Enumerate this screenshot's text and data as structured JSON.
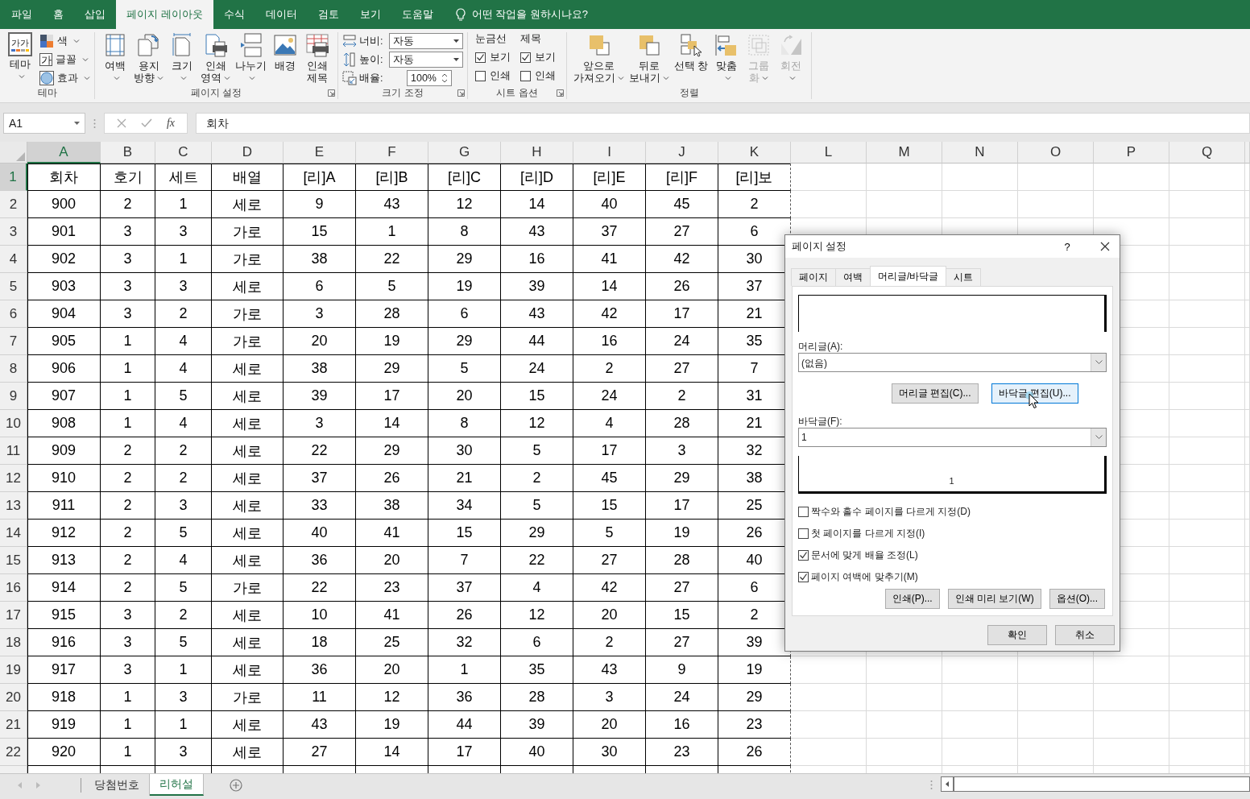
{
  "ribbon_tabs": [
    {
      "label": "파일",
      "selected": false
    },
    {
      "label": "홈",
      "selected": false
    },
    {
      "label": "삽입",
      "selected": false
    },
    {
      "label": "페이지 레이아웃",
      "selected": true
    },
    {
      "label": "수식",
      "selected": false
    },
    {
      "label": "데이터",
      "selected": false
    },
    {
      "label": "검토",
      "selected": false
    },
    {
      "label": "보기",
      "selected": false
    },
    {
      "label": "도움말",
      "selected": false
    }
  ],
  "tell_me": "어떤 작업을 원하시나요?",
  "ribbon_groups": [
    {
      "kind": "theme",
      "label": "테마",
      "buttons": [
        {
          "kind": "theme",
          "glyph": "가가",
          "lines": [
            "테마"
          ],
          "menu": true,
          "disabled": false
        }
      ],
      "small_items": [
        {
          "kind": "colors",
          "label": "색",
          "menu": true
        },
        {
          "kind": "fonts",
          "glyph": "가",
          "label": "글꼴",
          "menu": true
        },
        {
          "kind": "effects",
          "label": "효과",
          "menu": true
        }
      ]
    },
    {
      "kind": "buttons",
      "label": "페이지 설정",
      "launcher": true,
      "buttons": [
        {
          "kind": "margins",
          "lines": [
            "여백"
          ],
          "menu": true,
          "disabled": false
        },
        {
          "kind": "orientation",
          "lines": [
            "용지",
            "방향"
          ],
          "menu": true,
          "disabled": false
        },
        {
          "kind": "size",
          "lines": [
            "크기"
          ],
          "menu": true,
          "disabled": false
        },
        {
          "kind": "print_area",
          "lines": [
            "인쇄",
            "영역"
          ],
          "menu": true,
          "disabled": false
        },
        {
          "kind": "breaks",
          "lines": [
            "나누기"
          ],
          "menu": true,
          "disabled": false
        },
        {
          "kind": "background",
          "lines": [
            "배경"
          ],
          "menu": false,
          "disabled": false
        },
        {
          "kind": "print_titles",
          "lines": [
            "인쇄",
            "제목"
          ],
          "menu": false,
          "disabled": false
        }
      ]
    },
    {
      "kind": "scale",
      "label": "크기 조정",
      "launcher": true,
      "fields": [
        {
          "kind": "dropdown",
          "label": "너비:",
          "value": "자동"
        },
        {
          "kind": "dropdown",
          "label": "높이:",
          "value": "자동"
        },
        {
          "kind": "spinner",
          "label": "배율:",
          "value": "100%"
        }
      ]
    },
    {
      "kind": "sheet_options",
      "label": "시트 옵션",
      "launcher": true,
      "columns": [
        {
          "title": "눈금선",
          "items": [
            {
              "label": "보기",
              "checked": true
            },
            {
              "label": "인쇄",
              "checked": false
            }
          ]
        },
        {
          "title": "제목",
          "items": [
            {
              "label": "보기",
              "checked": true
            },
            {
              "label": "인쇄",
              "checked": false
            }
          ]
        }
      ]
    },
    {
      "kind": "buttons",
      "label": "정렬",
      "launcher": false,
      "buttons": [
        {
          "kind": "bring_forward",
          "lines": [
            "앞으로",
            "가져오기"
          ],
          "menu": true,
          "disabled": false
        },
        {
          "kind": "send_backward",
          "lines": [
            "뒤로",
            "보내기"
          ],
          "menu": true,
          "disabled": false
        },
        {
          "kind": "selection_pane",
          "lines": [
            "선택 창"
          ],
          "menu": false,
          "disabled": false
        },
        {
          "kind": "align",
          "lines": [
            "맞춤"
          ],
          "menu": true,
          "disabled": false
        },
        {
          "kind": "group",
          "lines": [
            "그룹",
            "화"
          ],
          "menu": true,
          "disabled": true
        },
        {
          "kind": "rotate",
          "lines": [
            "회전"
          ],
          "menu": true,
          "disabled": true
        }
      ]
    }
  ],
  "formula_bar": {
    "name_box": "A1",
    "function_label": "fx",
    "value": "회차"
  },
  "sheet": {
    "columns": [
      {
        "label": "A",
        "selected": true
      },
      {
        "label": "B",
        "selected": false
      },
      {
        "label": "C",
        "selected": false
      },
      {
        "label": "D",
        "selected": false
      },
      {
        "label": "E",
        "selected": false
      },
      {
        "label": "F",
        "selected": false
      },
      {
        "label": "G",
        "selected": false
      },
      {
        "label": "H",
        "selected": false
      },
      {
        "label": "I",
        "selected": false
      },
      {
        "label": "J",
        "selected": false
      },
      {
        "label": "K",
        "selected": false
      },
      {
        "label": "L",
        "selected": false
      },
      {
        "label": "M",
        "selected": false
      },
      {
        "label": "N",
        "selected": false
      },
      {
        "label": "O",
        "selected": false
      },
      {
        "label": "P",
        "selected": false
      },
      {
        "label": "Q",
        "selected": false
      }
    ],
    "rows": [
      {
        "label": "1",
        "selected": true,
        "cells": [
          "회차",
          "호기",
          "세트",
          "배열",
          "[리]A",
          "[리]B",
          "[리]C",
          "[리]D",
          "[리]E",
          "[리]F",
          "[리]보"
        ]
      },
      {
        "label": "2",
        "selected": false,
        "cells": [
          "900",
          "2",
          "1",
          "세로",
          "9",
          "43",
          "12",
          "14",
          "40",
          "45",
          "2"
        ]
      },
      {
        "label": "3",
        "selected": false,
        "cells": [
          "901",
          "3",
          "3",
          "가로",
          "15",
          "1",
          "8",
          "43",
          "37",
          "27",
          "6"
        ]
      },
      {
        "label": "4",
        "selected": false,
        "cells": [
          "902",
          "3",
          "1",
          "가로",
          "38",
          "22",
          "29",
          "16",
          "41",
          "42",
          "30"
        ]
      },
      {
        "label": "5",
        "selected": false,
        "cells": [
          "903",
          "3",
          "3",
          "세로",
          "6",
          "5",
          "19",
          "39",
          "14",
          "26",
          "37"
        ]
      },
      {
        "label": "6",
        "selected": false,
        "cells": [
          "904",
          "3",
          "2",
          "가로",
          "3",
          "28",
          "6",
          "43",
          "42",
          "17",
          "21"
        ]
      },
      {
        "label": "7",
        "selected": false,
        "cells": [
          "905",
          "1",
          "4",
          "가로",
          "20",
          "19",
          "29",
          "44",
          "16",
          "24",
          "35"
        ]
      },
      {
        "label": "8",
        "selected": false,
        "cells": [
          "906",
          "1",
          "4",
          "세로",
          "38",
          "29",
          "5",
          "24",
          "2",
          "27",
          "7"
        ]
      },
      {
        "label": "9",
        "selected": false,
        "cells": [
          "907",
          "1",
          "5",
          "세로",
          "39",
          "17",
          "20",
          "15",
          "24",
          "2",
          "31"
        ]
      },
      {
        "label": "10",
        "selected": false,
        "cells": [
          "908",
          "1",
          "4",
          "세로",
          "3",
          "14",
          "8",
          "12",
          "4",
          "28",
          "21"
        ]
      },
      {
        "label": "11",
        "selected": false,
        "cells": [
          "909",
          "2",
          "2",
          "세로",
          "22",
          "29",
          "30",
          "5",
          "17",
          "3",
          "32"
        ]
      },
      {
        "label": "12",
        "selected": false,
        "cells": [
          "910",
          "2",
          "2",
          "세로",
          "37",
          "26",
          "21",
          "2",
          "45",
          "29",
          "38"
        ]
      },
      {
        "label": "13",
        "selected": false,
        "cells": [
          "911",
          "2",
          "3",
          "세로",
          "33",
          "38",
          "34",
          "5",
          "15",
          "17",
          "25"
        ]
      },
      {
        "label": "14",
        "selected": false,
        "cells": [
          "912",
          "2",
          "5",
          "세로",
          "40",
          "41",
          "15",
          "29",
          "5",
          "19",
          "26"
        ]
      },
      {
        "label": "15",
        "selected": false,
        "cells": [
          "913",
          "2",
          "4",
          "세로",
          "36",
          "20",
          "7",
          "22",
          "27",
          "28",
          "40"
        ]
      },
      {
        "label": "16",
        "selected": false,
        "cells": [
          "914",
          "2",
          "5",
          "가로",
          "22",
          "23",
          "37",
          "4",
          "42",
          "27",
          "6"
        ]
      },
      {
        "label": "17",
        "selected": false,
        "cells": [
          "915",
          "3",
          "2",
          "세로",
          "10",
          "41",
          "26",
          "12",
          "20",
          "15",
          "2"
        ]
      },
      {
        "label": "18",
        "selected": false,
        "cells": [
          "916",
          "3",
          "5",
          "세로",
          "18",
          "25",
          "32",
          "6",
          "2",
          "27",
          "39"
        ]
      },
      {
        "label": "19",
        "selected": false,
        "cells": [
          "917",
          "3",
          "1",
          "세로",
          "36",
          "20",
          "1",
          "35",
          "43",
          "9",
          "19"
        ]
      },
      {
        "label": "20",
        "selected": false,
        "cells": [
          "918",
          "1",
          "3",
          "가로",
          "11",
          "12",
          "36",
          "28",
          "3",
          "24",
          "29"
        ]
      },
      {
        "label": "21",
        "selected": false,
        "cells": [
          "919",
          "1",
          "1",
          "세로",
          "43",
          "19",
          "44",
          "39",
          "20",
          "16",
          "23"
        ]
      },
      {
        "label": "22",
        "selected": false,
        "cells": [
          "920",
          "1",
          "3",
          "세로",
          "27",
          "14",
          "17",
          "40",
          "30",
          "23",
          "26"
        ]
      }
    ]
  },
  "sheet_tabs": [
    {
      "label": "당첨번호",
      "selected": false
    },
    {
      "label": "리허설",
      "selected": true
    }
  ],
  "dialog": {
    "title": "페이지 설정",
    "help": "?",
    "tabs": [
      {
        "label": "페이지",
        "selected": false
      },
      {
        "label": "여백",
        "selected": false
      },
      {
        "label": "머리글/바닥글",
        "selected": true
      },
      {
        "label": "시트",
        "selected": false
      }
    ],
    "header_label": "머리글(A):",
    "header_value": "(없음)",
    "edit_buttons": [
      {
        "label": "머리글 편집(C)...",
        "hovered": false
      },
      {
        "label": "바닥글 편집(U)...",
        "hovered": true
      }
    ],
    "footer_label": "바닥글(F):",
    "footer_value": "1",
    "footer_preview": "1",
    "options": [
      {
        "label": "짝수와 홀수 페이지를 다르게 지정(D)",
        "checked": false
      },
      {
        "label": "첫 페이지를 다르게 지정(I)",
        "checked": false
      },
      {
        "label": "문서에 맞게 배율 조정(L)",
        "checked": true
      },
      {
        "label": "페이지 여백에 맞추기(M)",
        "checked": true
      }
    ],
    "action_buttons": [
      "인쇄(P)...",
      "인쇄 미리 보기(W)",
      "옵션(O)..."
    ],
    "buttons": [
      "확인",
      "취소"
    ]
  }
}
